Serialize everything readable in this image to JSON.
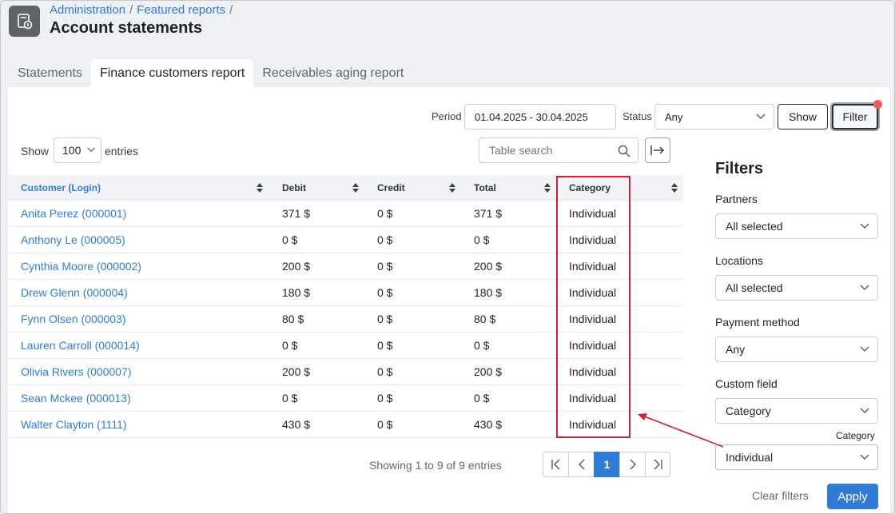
{
  "header": {
    "breadcrumb": [
      "Administration",
      "Featured reports"
    ],
    "separator": "/",
    "title": "Account statements"
  },
  "tabs": [
    {
      "label": "Statements"
    },
    {
      "label": "Finance customers report"
    },
    {
      "label": "Receivables aging report"
    }
  ],
  "toolbar": {
    "period_label": "Period",
    "period_value": "01.04.2025 - 30.04.2025",
    "status_label": "Status",
    "status_value": "Any",
    "show_label": "Show",
    "filter_label": "Filter"
  },
  "table_controls": {
    "show_label": "Show",
    "entries_value": "100",
    "entries_label": "entries",
    "search_placeholder": "Table search"
  },
  "table": {
    "columns": [
      "Customer (Login)",
      "Debit",
      "Credit",
      "Total",
      "Category"
    ],
    "rows": [
      [
        "Anita Perez (000001)",
        "371 $",
        "0 $",
        "371 $",
        "Individual"
      ],
      [
        "Anthony Le (000005)",
        "0 $",
        "0 $",
        "0 $",
        "Individual"
      ],
      [
        "Cynthia Moore (000002)",
        "200 $",
        "0 $",
        "200 $",
        "Individual"
      ],
      [
        "Drew Glenn (000004)",
        "180 $",
        "0 $",
        "180 $",
        "Individual"
      ],
      [
        "Fynn Olsen (000003)",
        "80 $",
        "0 $",
        "80 $",
        "Individual"
      ],
      [
        "Lauren Carroll (000014)",
        "0 $",
        "0 $",
        "0 $",
        "Individual"
      ],
      [
        "Olivia Rivers (000007)",
        "200 $",
        "0 $",
        "200 $",
        "Individual"
      ],
      [
        "Sean Mckee (000013)",
        "0 $",
        "0 $",
        "0 $",
        "Individual"
      ],
      [
        "Walter Clayton (1111)",
        "430 $",
        "0 $",
        "430 $",
        "Individual"
      ]
    ],
    "info": "Showing 1 to 9 of 9 entries",
    "current_page": "1"
  },
  "filters": {
    "title": "Filters",
    "partners_label": "Partners",
    "partners_value": "All selected",
    "locations_label": "Locations",
    "locations_value": "All selected",
    "payment_label": "Payment method",
    "payment_value": "Any",
    "custom_field_label": "Custom field",
    "custom_field_value": "Category",
    "category_label": "Category",
    "category_value": "Individual",
    "clear_label": "Clear filters",
    "apply_label": "Apply"
  },
  "colors": {
    "accent": "#2f7bd6",
    "highlight": "#c8232c",
    "notification_dot": "#f25a5a"
  }
}
